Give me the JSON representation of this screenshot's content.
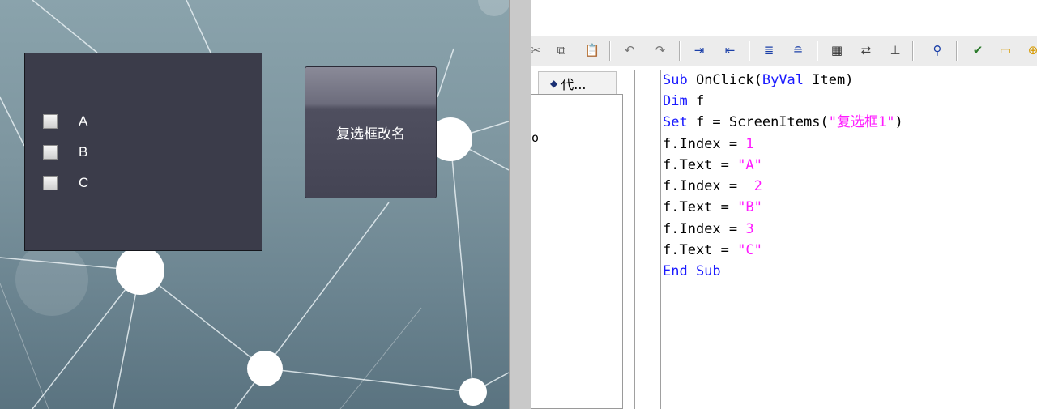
{
  "hmi": {
    "checkbox_group": {
      "items": [
        {
          "label": "A",
          "checked": false
        },
        {
          "label": "B",
          "checked": false
        },
        {
          "label": "C",
          "checked": false
        }
      ]
    },
    "rename_button": {
      "label": "复选框改名"
    }
  },
  "editor": {
    "left_pane": {
      "tab_label": "代...",
      "visible_text": "o"
    },
    "code": {
      "line1": {
        "kw": "Sub",
        "rest": " OnClick(",
        "kw2": "ByVal",
        "rest2": " Item)"
      },
      "line2": {
        "kw": "Dim",
        "rest": " f"
      },
      "line3": {
        "kw": "Set",
        "rest": " f = ScreenItems(",
        "str": "\"复选框1\"",
        "tail": ")"
      },
      "line4": {
        "text": "f.Index = ",
        "num": "1"
      },
      "line5": {
        "text": "f.Text = ",
        "str": "\"A\""
      },
      "line6": {
        "text": "f.Index =  ",
        "num": "2"
      },
      "line7": {
        "text": "f.Text = ",
        "str": "\"B\""
      },
      "line8": {
        "text": "f.Index = ",
        "num": "3"
      },
      "line9": {
        "text": "f.Text = ",
        "str": "\"C\""
      },
      "line10": {
        "kw": "End Sub"
      }
    }
  },
  "toolbar_icons": [
    "cut-icon",
    "copy-icon",
    "paste-icon",
    "undo-icon",
    "redo-icon",
    "indent-icon",
    "outdent-icon",
    "comment-icon",
    "uncomment-icon",
    "find-icon",
    "replace-icon",
    "bookmark-icon",
    "tools-icon",
    "check-icon",
    "folder-icon",
    "new-icon"
  ],
  "colors": {
    "keyword": "#1a1aff",
    "string": "#ff1aff",
    "panel": "#3b3c4a"
  }
}
